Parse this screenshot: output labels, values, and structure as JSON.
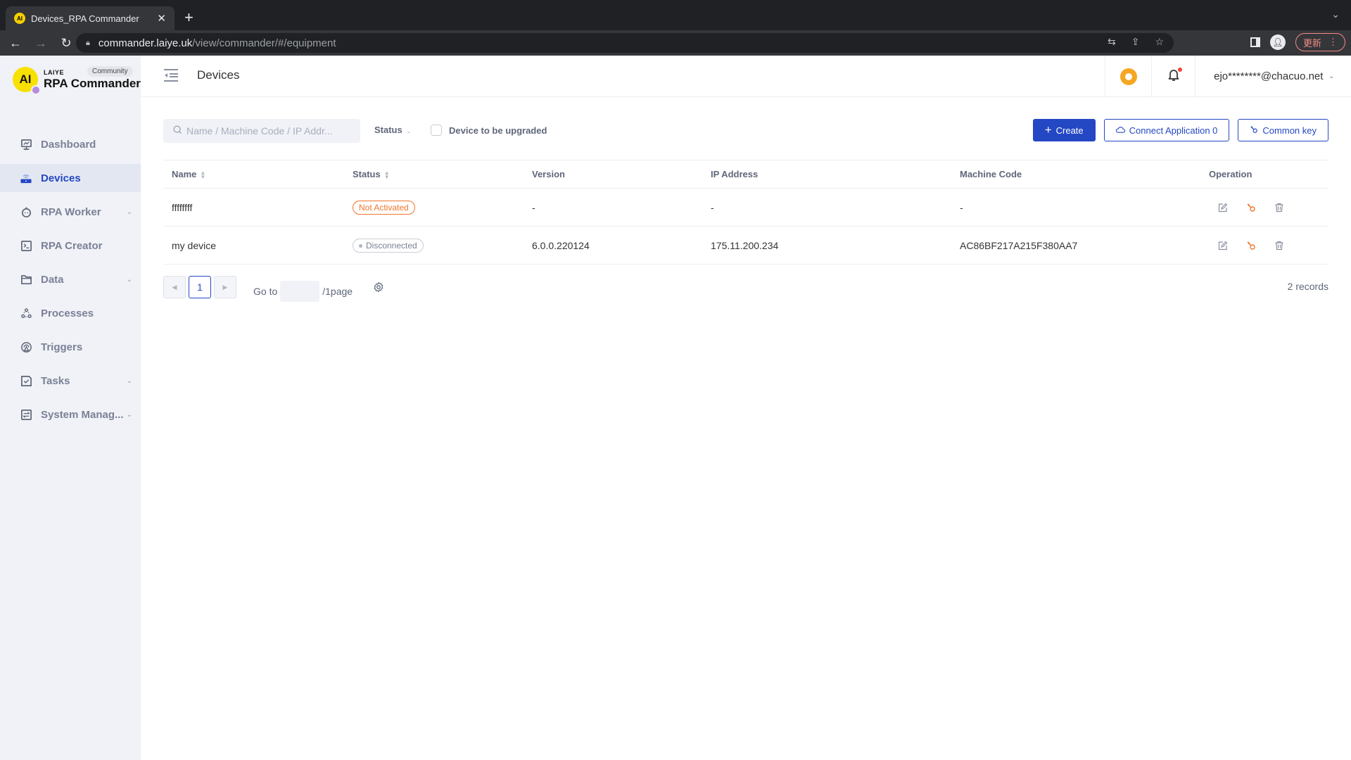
{
  "browser": {
    "tab_title": "Devices_RPA Commander",
    "url_host": "commander.laiye.uk",
    "url_path": "/view/commander/#/equipment",
    "update_label": "更新"
  },
  "brand": {
    "mark": "AI",
    "company": "LAIYE",
    "product": "RPA Commander",
    "edition": "Community"
  },
  "sidebar": {
    "items": [
      {
        "label": "Dashboard",
        "icon": "monitor-chart-icon",
        "active": false,
        "expandable": false
      },
      {
        "label": "Devices",
        "icon": "router-icon",
        "active": true,
        "expandable": false
      },
      {
        "label": "RPA Worker",
        "icon": "robot-icon",
        "active": false,
        "expandable": true
      },
      {
        "label": "RPA Creator",
        "icon": "terminal-icon",
        "active": false,
        "expandable": false
      },
      {
        "label": "Data",
        "icon": "folder-icon",
        "active": false,
        "expandable": true
      },
      {
        "label": "Processes",
        "icon": "processes-icon",
        "active": false,
        "expandable": false
      },
      {
        "label": "Triggers",
        "icon": "trigger-icon",
        "active": false,
        "expandable": false
      },
      {
        "label": "Tasks",
        "icon": "task-check-icon",
        "active": false,
        "expandable": true
      },
      {
        "label": "System Manag...",
        "icon": "system-settings-icon",
        "active": false,
        "expandable": true
      }
    ]
  },
  "header": {
    "title": "Devices",
    "user": "ejo********@chacuo.net",
    "notification_dot": true
  },
  "toolbar": {
    "search_placeholder": "Name / Machine Code / IP Addr...",
    "status_label": "Status",
    "upgrade_label": "Device to be upgraded",
    "create_label": "Create",
    "connect_label": "Connect Application 0",
    "common_key_label": "Common key"
  },
  "table": {
    "columns": [
      "Name",
      "Status",
      "Version",
      "IP Address",
      "Machine Code",
      "Operation"
    ],
    "rows": [
      {
        "name": "ffffffff",
        "status": "Not Activated",
        "status_type": "orange",
        "version": "-",
        "ip": "-",
        "machine_code": "-"
      },
      {
        "name": "my device",
        "status": "Disconnected",
        "status_type": "gray",
        "version": "6.0.0.220124",
        "ip": "175.11.200.234",
        "machine_code": "AC86BF217A215F380AA7"
      }
    ]
  },
  "pagination": {
    "current_page": "1",
    "goto_label": "Go to",
    "goto_value": "",
    "total_pages_label": "/1page",
    "records_label": "2 records"
  },
  "colors": {
    "accent": "#2447c4",
    "warning": "#f0752b",
    "sidebar_bg": "#f0f2f7"
  }
}
